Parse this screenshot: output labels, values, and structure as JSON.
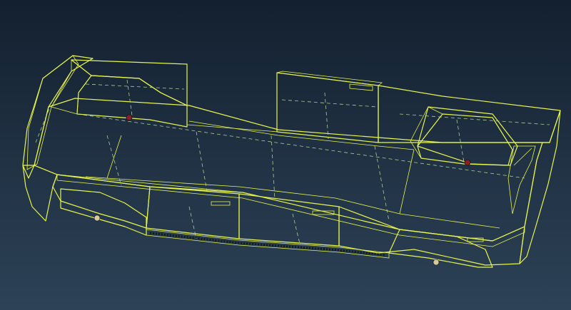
{
  "viewport": {
    "background_top": "#13202f",
    "background_bottom": "#2d4257"
  },
  "model": {
    "object": "bus-body-shell",
    "render_mode": "shaded-with-edges",
    "colors": {
      "face_light": "#74cc74",
      "face_mid": "#5fb95f",
      "face_dark": "#3f8a3a",
      "face_shadow": "#2f6a2a",
      "edge": "#e7f54a",
      "hidden_edge": "#b9e0a0",
      "marker": "#8a1f2a",
      "marker_light": "#d8c9a0",
      "dark_detail": "#141a14"
    }
  }
}
